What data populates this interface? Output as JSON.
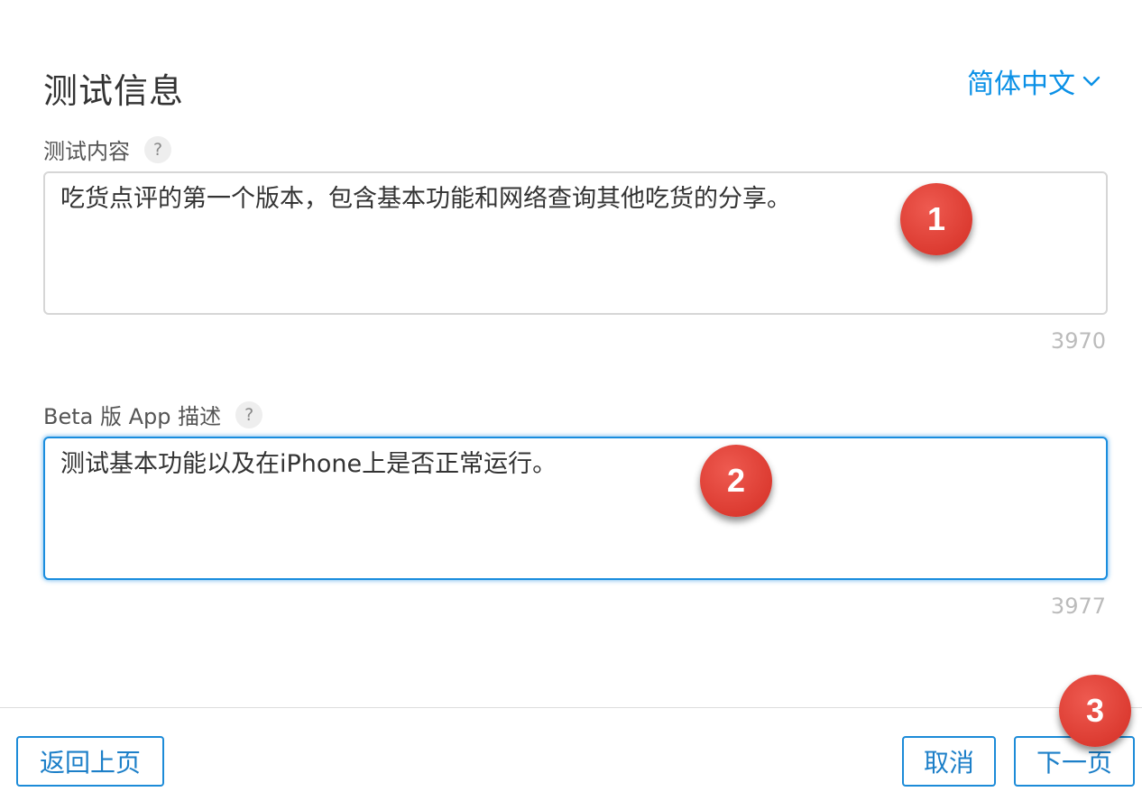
{
  "header": {
    "title": "测试信息",
    "language": "简体中文",
    "language_icon": "chevron-down-icon"
  },
  "fields": [
    {
      "label": "测试内容",
      "help": "?",
      "value": "吃货点评的第一个版本，包含基本功能和网络查询其他吃货的分享。",
      "remaining": "3970"
    },
    {
      "label": "Beta 版 App 描述",
      "help": "?",
      "value": "测试基本功能以及在iPhone上是否正常运行。",
      "remaining": "3977"
    }
  ],
  "footer": {
    "back_label": "返回上页",
    "cancel_label": "取消",
    "next_label": "下一页"
  },
  "callouts": [
    "1",
    "2",
    "3"
  ],
  "colors": {
    "accent": "#1c8bd8",
    "callout": "#dc3b31",
    "focus_border": "#1a8dde"
  }
}
